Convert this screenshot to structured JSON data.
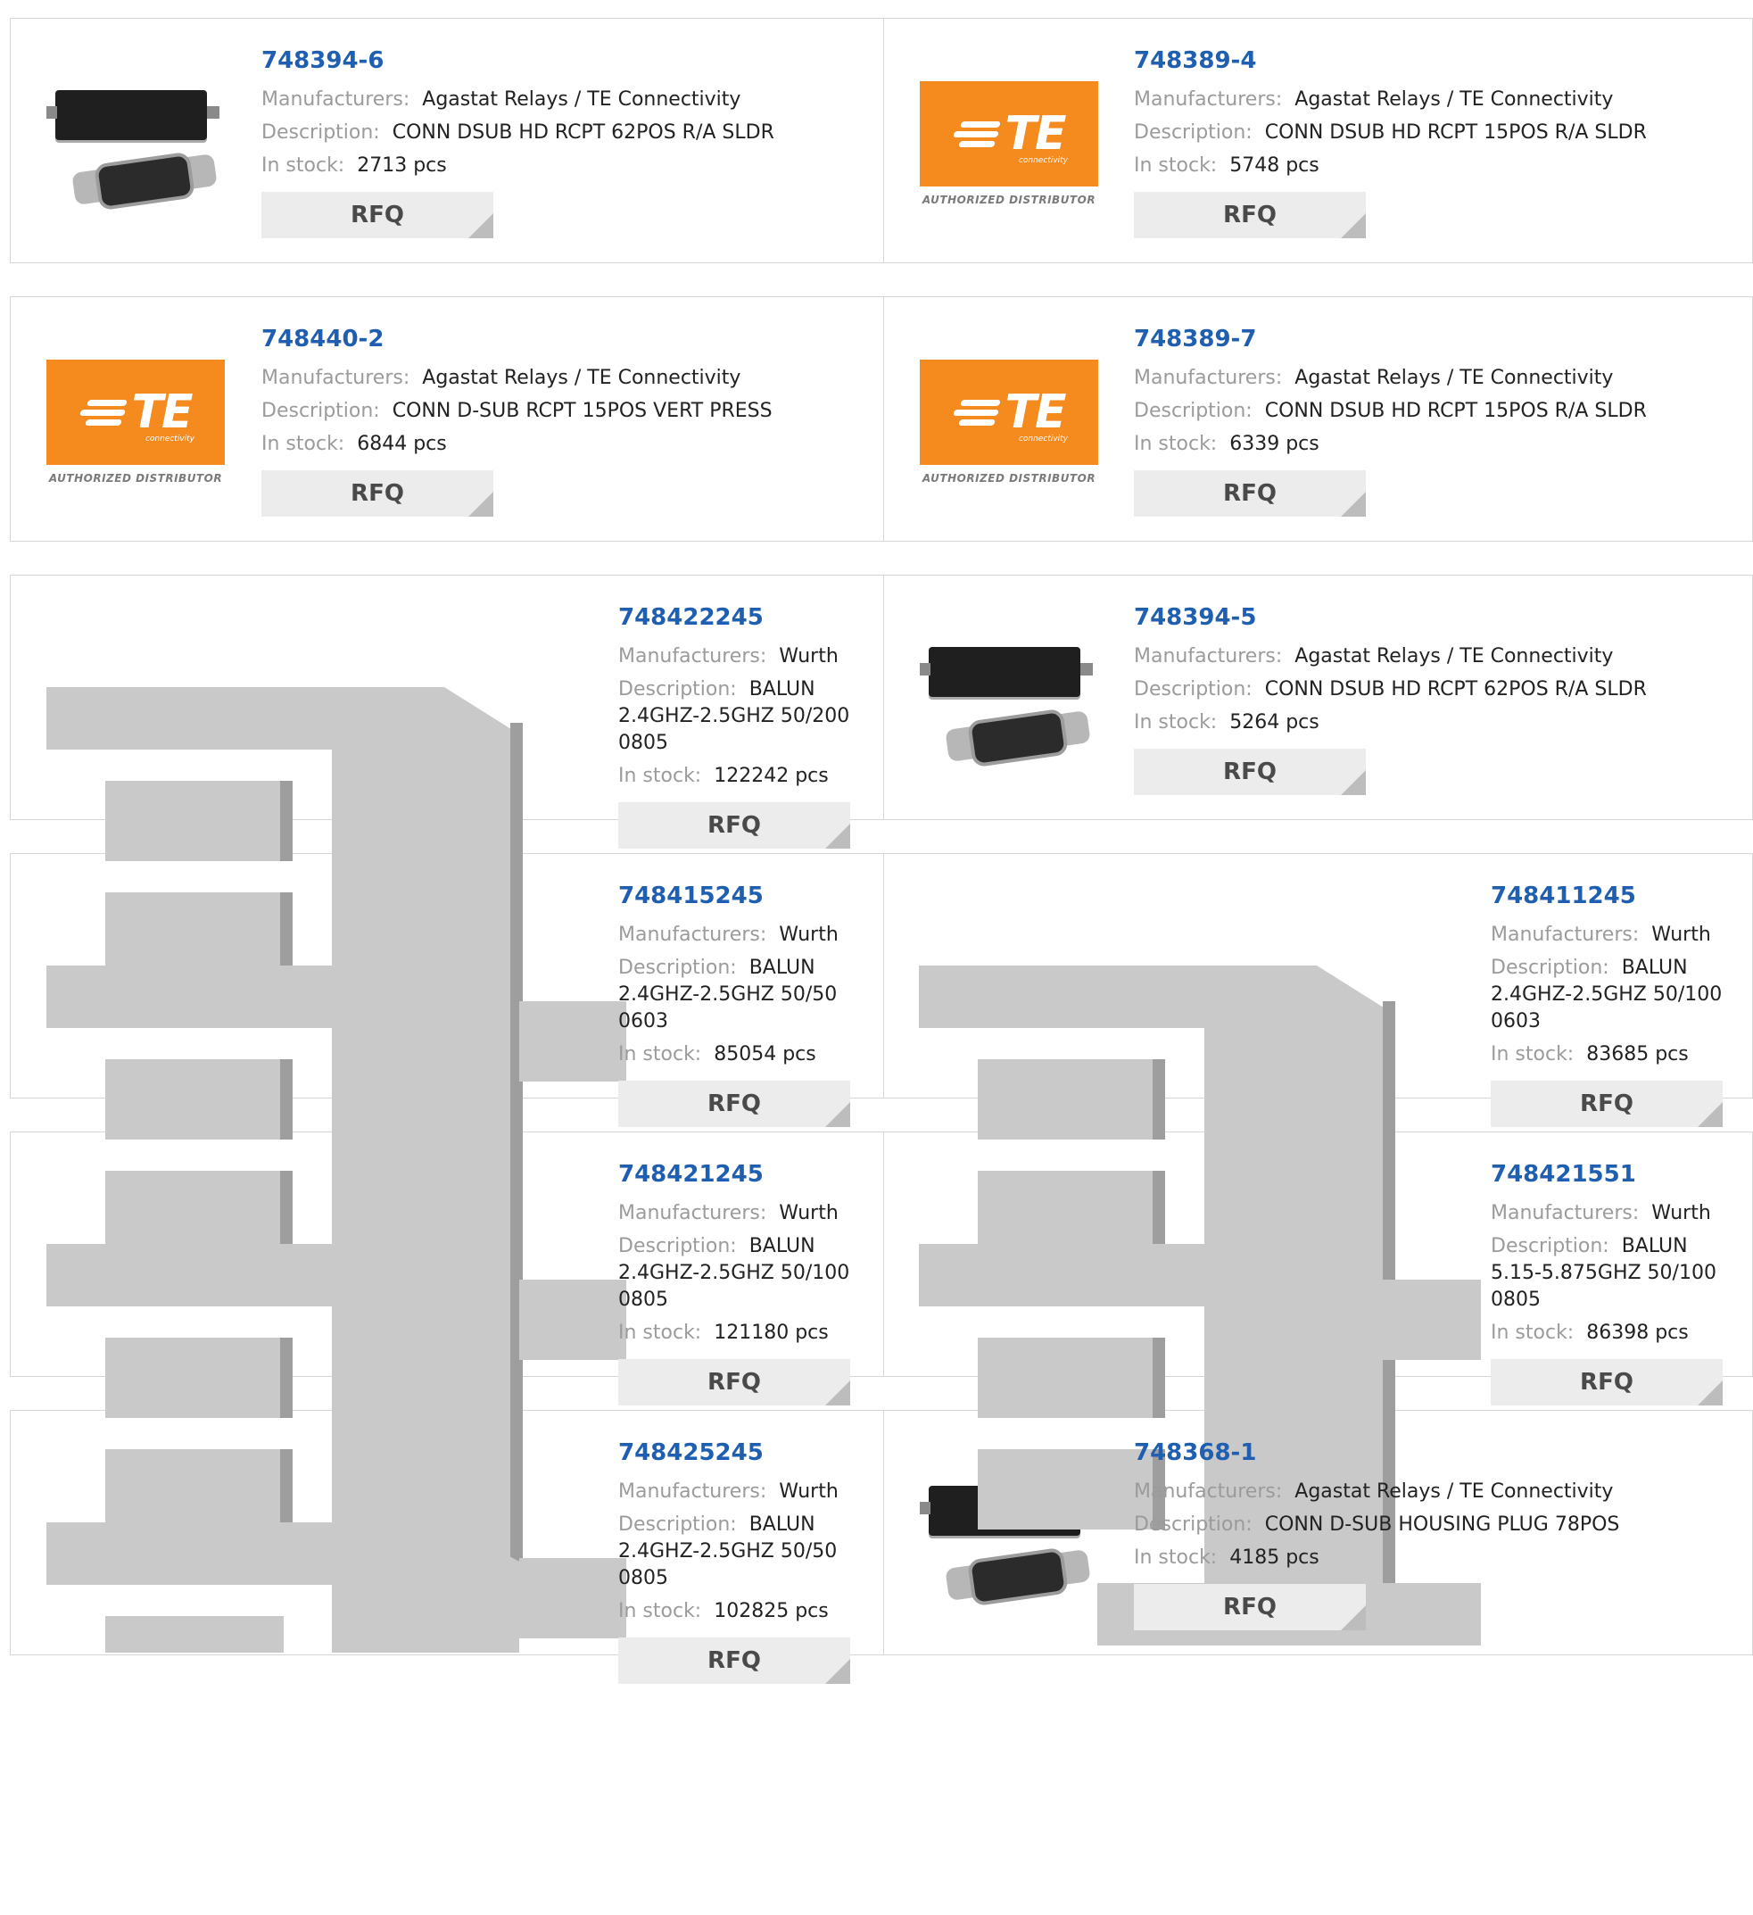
{
  "labels": {
    "manufacturers": "Manufacturers:",
    "description": "Description:",
    "stock": "In stock:",
    "rfq": "RFQ"
  },
  "te_logo": {
    "letters": "TE",
    "sub": "connectivity",
    "caption": "AUTHORIZED DISTRIBUTOR",
    "color": "#f58a1f"
  },
  "products": [
    {
      "pn": "748394-6",
      "mfr": "Agastat Relays / TE Connectivity",
      "desc": "CONN DSUB HD RCPT 62POS R/A SLDR",
      "stock": "2713 pcs",
      "image": "dsub-connector-photo"
    },
    {
      "pn": "748389-4",
      "mfr": "Agastat Relays / TE Connectivity",
      "desc": "CONN DSUB HD RCPT 15POS R/A SLDR",
      "stock": "5748 pcs",
      "image": "te-connectivity-logo"
    },
    {
      "pn": "748440-2",
      "mfr": "Agastat Relays / TE Connectivity",
      "desc": "CONN D-SUB RCPT 15POS VERT PRESS",
      "stock": "6844 pcs",
      "image": "te-connectivity-logo"
    },
    {
      "pn": "748389-7",
      "mfr": "Agastat Relays / TE Connectivity",
      "desc": "CONN DSUB HD RCPT 15POS R/A SLDR",
      "stock": "6339 pcs",
      "image": "te-connectivity-logo"
    },
    {
      "pn": "748422245",
      "mfr": "Wurth",
      "desc": "BALUN 2.4GHZ-2.5GHZ 50/200 0805",
      "stock": "122242 pcs",
      "image": "chip-placeholder"
    },
    {
      "pn": "748394-5",
      "mfr": "Agastat Relays / TE Connectivity",
      "desc": "CONN DSUB HD RCPT 62POS R/A SLDR",
      "stock": "5264 pcs",
      "image": "dsub-connector-photo"
    },
    {
      "pn": "748415245",
      "mfr": "Wurth",
      "desc": "BALUN 2.4GHZ-2.5GHZ 50/50 0603",
      "stock": "85054 pcs",
      "image": "chip-placeholder"
    },
    {
      "pn": "748411245",
      "mfr": "Wurth",
      "desc": "BALUN 2.4GHZ-2.5GHZ 50/100 0603",
      "stock": "83685 pcs",
      "image": "chip-placeholder"
    },
    {
      "pn": "748421245",
      "mfr": "Wurth",
      "desc": "BALUN 2.4GHZ-2.5GHZ 50/100 0805",
      "stock": "121180 pcs",
      "image": "chip-placeholder"
    },
    {
      "pn": "748421551",
      "mfr": "Wurth",
      "desc": "BALUN 5.15-5.875GHZ 50/100 0805",
      "stock": "86398 pcs",
      "image": "chip-placeholder"
    },
    {
      "pn": "748425245",
      "mfr": "Wurth",
      "desc": "BALUN 2.4GHZ-2.5GHZ 50/50 0805",
      "stock": "102825 pcs",
      "image": "chip-placeholder"
    },
    {
      "pn": "748368-1",
      "mfr": "Agastat Relays / TE Connectivity",
      "desc": "CONN D-SUB HOUSING PLUG 78POS",
      "stock": "4185 pcs",
      "image": "dsub-connector-photo"
    }
  ]
}
